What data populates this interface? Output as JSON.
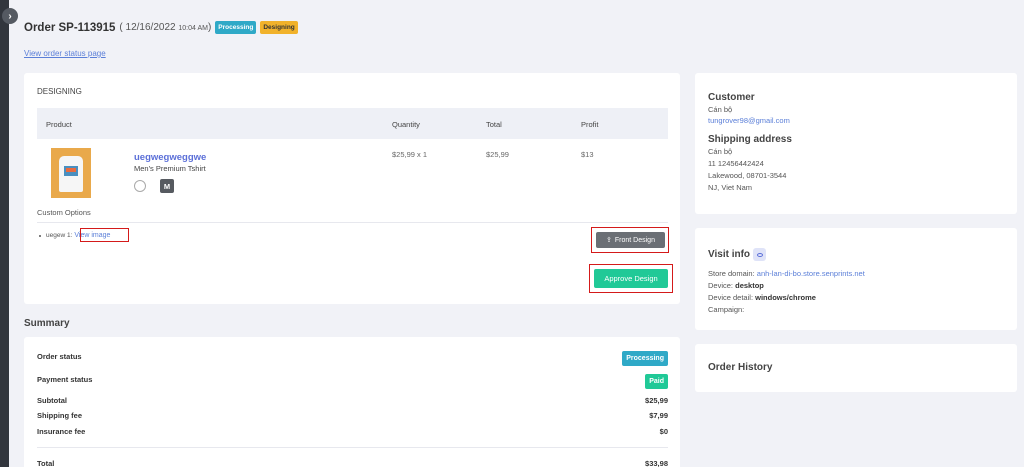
{
  "header": {
    "order_id": "Order SP-113915",
    "date_prefix": "( 12/16/2022",
    "time": "10:04 AM",
    "date_suffix": ")",
    "status_badge": "Processing",
    "design_badge": "Designing",
    "status_link": "View order status page"
  },
  "colors": {
    "processing": "#2fa9c7",
    "designing": "#f1b22b",
    "approve": "#20c997",
    "link": "#5b7fd8",
    "highlight": "#d41a1a"
  },
  "design_section": {
    "title": "DESIGNING",
    "columns": [
      "Product",
      "Quantity",
      "Total",
      "Profit"
    ],
    "product": {
      "name": "uegwegweggwe",
      "variant": "Men's Premium Tshirt",
      "size": "M",
      "quantity": "$25,99 x 1",
      "total": "$25,99",
      "profit": "$13"
    },
    "custom_options_title": "Custom Options",
    "option_label": "uegew 1:",
    "option_link": "View image",
    "front_design_button": "Front Design",
    "approve_button": "Approve Design"
  },
  "summary": {
    "heading": "Summary",
    "order_status_label": "Order status",
    "order_status_value": "Processing",
    "payment_status_label": "Payment status",
    "payment_status_value": "Paid",
    "subtotal_label": "Subtotal",
    "subtotal_value": "$25,99",
    "shipping_label": "Shipping fee",
    "shipping_value": "$7,99",
    "insurance_label": "Insurance fee",
    "insurance_value": "$0",
    "total_label": "Total",
    "total_value": "$33,98"
  },
  "customer": {
    "title": "Customer",
    "name": "Cán bộ",
    "email": "tungrover98@gmail.com",
    "shipping_title": "Shipping address",
    "ship_name": "Cán bộ",
    "ship_line1": "11 12456442424",
    "ship_line2": "Lakewood, 08701-3544",
    "ship_line3": "NJ, Viet Nam"
  },
  "visit": {
    "title": "Visit info",
    "store_label": "Store domain:",
    "store_value": "anh-lan-di-bo.store.senprints.net",
    "device_label": "Device:",
    "device_value": "desktop",
    "detail_label": "Device detail:",
    "detail_value": "windows/chrome",
    "campaign_label": "Campaign:"
  },
  "history": {
    "title": "Order History"
  }
}
